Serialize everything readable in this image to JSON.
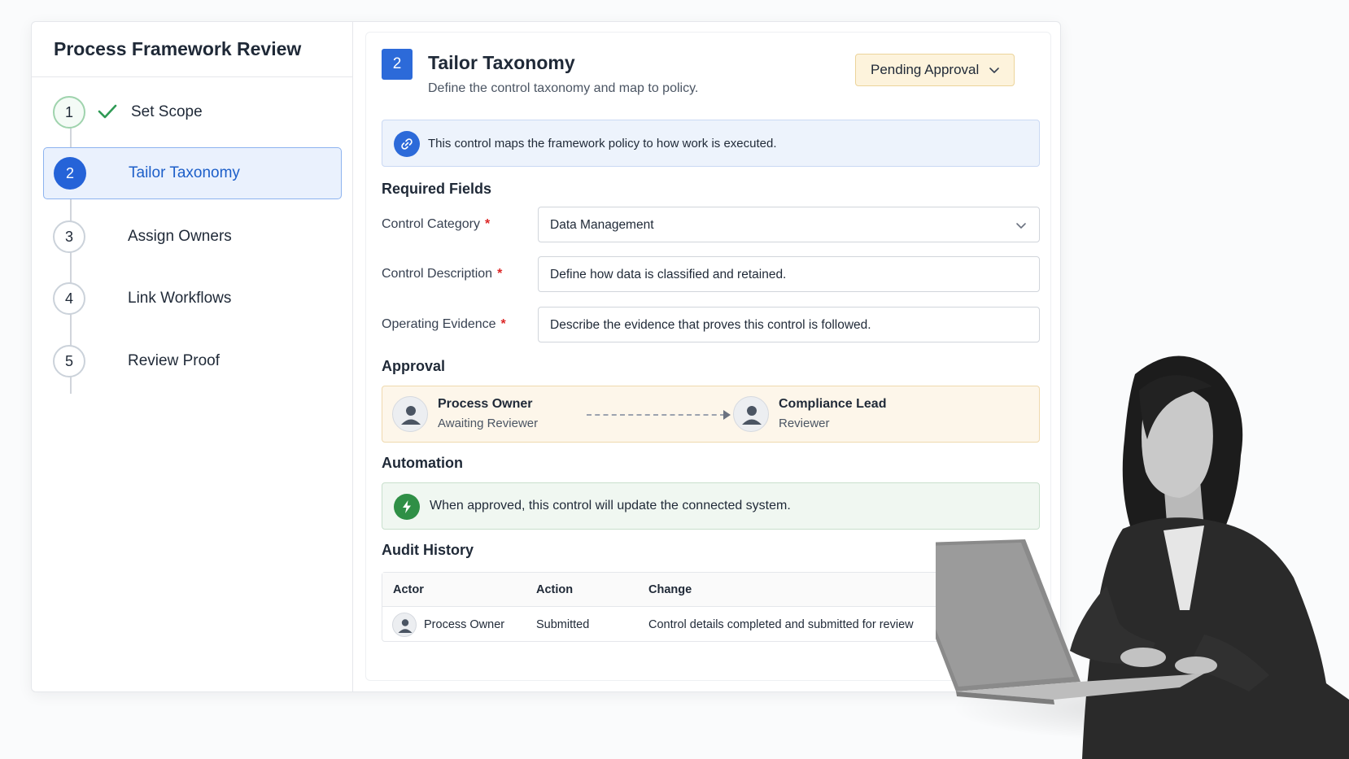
{
  "sidebar": {
    "title": "Process Framework Review",
    "steps": [
      {
        "number": "1",
        "label": "Set Scope",
        "state": "completed"
      },
      {
        "number": "2",
        "label": "Tailor Taxonomy",
        "state": "active"
      },
      {
        "number": "3",
        "label": "Assign Owners",
        "state": "pending"
      },
      {
        "number": "4",
        "label": "Link Workflows",
        "state": "pending"
      },
      {
        "number": "5",
        "label": "Review Proof",
        "state": "pending"
      }
    ]
  },
  "main": {
    "step_number": "2",
    "title": "Tailor Taxonomy",
    "subtitle": "Define the control taxonomy and map to policy.",
    "status": "Pending Approval",
    "info_banner": "This control maps the framework policy to how work is executed.",
    "required_heading": "Required Fields",
    "fields": {
      "category": {
        "label": "Control Category",
        "value": "Data Management",
        "required_mark": "*"
      },
      "description": {
        "label": "Control Description",
        "value": "Define how data is classified and retained.",
        "required_mark": "*"
      },
      "evidence": {
        "label": "Operating Evidence",
        "placeholder": "Describe the evidence that proves this control is followed.",
        "required_mark": "*"
      }
    },
    "approval": {
      "heading": "Approval",
      "from": {
        "name": "Process Owner",
        "role": "Awaiting Reviewer"
      },
      "to": {
        "name": "Compliance Lead",
        "role": "Reviewer"
      }
    },
    "automation": {
      "heading": "Automation",
      "text": "When approved, this control will update the connected system."
    },
    "audit": {
      "heading": "Audit History",
      "columns": [
        "Actor",
        "Action",
        "Change"
      ],
      "rows": [
        {
          "actor": "Process Owner",
          "action": "Submitted",
          "change": "Control details completed and submitted for review"
        }
      ]
    }
  },
  "colors": {
    "primary": "#2c6ad9",
    "active_bg": "#eaf1fd",
    "pending_bg": "#fdf3dc",
    "success": "#2f8f46",
    "required": "#dc2626"
  },
  "icons": {
    "check": "check-icon",
    "link": "link-icon",
    "bolt": "lightning-icon",
    "user": "user-icon",
    "chevron": "chevron-down-icon"
  }
}
